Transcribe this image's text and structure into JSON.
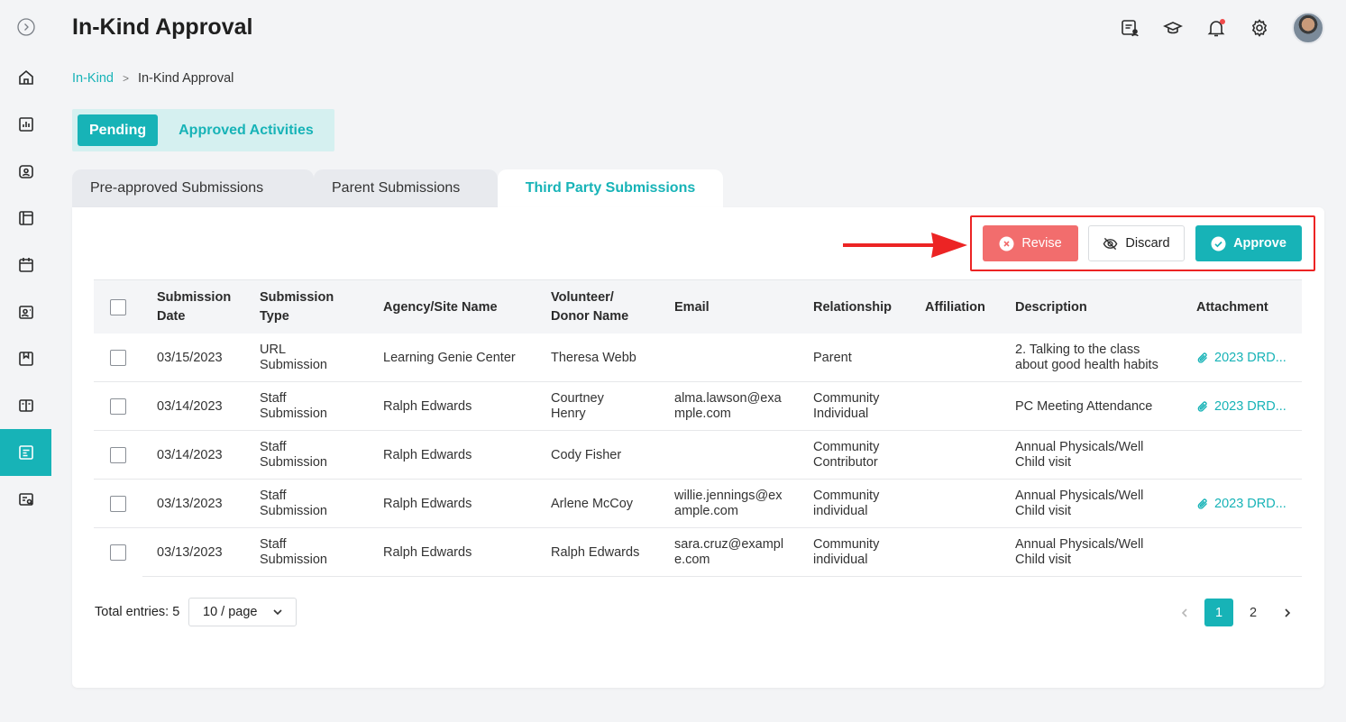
{
  "header": {
    "title": "In-Kind Approval",
    "icons": [
      "message-user-icon",
      "graduation-cap-icon",
      "bell-icon",
      "gear-icon",
      "avatar"
    ]
  },
  "breadcrumb": {
    "parent": "In-Kind",
    "separator": ">",
    "current": "In-Kind Approval"
  },
  "sidebar": {
    "items": [
      {
        "icon": "expand-icon"
      },
      {
        "icon": "home-icon"
      },
      {
        "icon": "bar-chart-icon"
      },
      {
        "icon": "id-card-icon"
      },
      {
        "icon": "layout-icon"
      },
      {
        "icon": "calendar-icon"
      },
      {
        "icon": "contact-card-icon"
      },
      {
        "icon": "bookmark-icon"
      },
      {
        "icon": "book-icon"
      },
      {
        "icon": "inkind-list-icon",
        "active": true
      },
      {
        "icon": "search-card-icon"
      }
    ]
  },
  "pill_tabs": {
    "pending": "Pending",
    "approved": "Approved Activities"
  },
  "folder_tabs": {
    "preapproved": "Pre-approved Submissions",
    "parent": "Parent Submissions",
    "third_party": "Third Party Submissions"
  },
  "actions": {
    "revise": "Revise",
    "discard": "Discard",
    "approve": "Approve"
  },
  "table": {
    "headers": {
      "date_1": "Submission",
      "date_2": "Date",
      "type_1": "Submission",
      "type_2": "Type",
      "agency": "Agency/Site Name",
      "volunteer_1": "Volunteer/",
      "volunteer_2": "Donor Name",
      "email": "Email",
      "relationship": "Relationship",
      "affiliation": "Affiliation",
      "description": "Description",
      "attachment": "Attachment"
    },
    "rows": [
      {
        "date": "03/15/2023",
        "type_1": "URL",
        "type_2": "Submission",
        "agency": "Learning Genie Center",
        "volunteer_1": "Theresa Webb",
        "volunteer_2": "",
        "email_1": "",
        "email_2": "",
        "relationship_1": "Parent",
        "relationship_2": "",
        "affiliation": "",
        "description_1": "2. Talking to the class",
        "description_2": "about good health habits",
        "attachment": "2023 DRD..."
      },
      {
        "date": "03/14/2023",
        "type_1": "Staff",
        "type_2": "Submission",
        "agency": "Ralph Edwards",
        "volunteer_1": "Courtney",
        "volunteer_2": "Henry",
        "email_1": "alma.lawson@exa",
        "email_2": "mple.com",
        "relationship_1": "Community",
        "relationship_2": "Individual",
        "affiliation": "",
        "description_1": "PC Meeting Attendance",
        "description_2": "",
        "attachment": "2023 DRD..."
      },
      {
        "date": "03/14/2023",
        "type_1": "Staff",
        "type_2": "Submission",
        "agency": "Ralph Edwards",
        "volunteer_1": "Cody Fisher",
        "volunteer_2": "",
        "email_1": "",
        "email_2": "",
        "relationship_1": "Community",
        "relationship_2": "Contributor",
        "affiliation": "",
        "description_1": "Annual Physicals/Well",
        "description_2": "Child visit",
        "attachment": ""
      },
      {
        "date": "03/13/2023",
        "type_1": "Staff",
        "type_2": "Submission",
        "agency": "Ralph Edwards",
        "volunteer_1": "Arlene McCoy",
        "volunteer_2": "",
        "email_1": "willie.jennings@ex",
        "email_2": "ample.com",
        "relationship_1": "Community",
        "relationship_2": "individual",
        "affiliation": "",
        "description_1": "Annual Physicals/Well",
        "description_2": "Child visit",
        "attachment": "2023 DRD..."
      },
      {
        "date": "03/13/2023",
        "type_1": "Staff",
        "type_2": "Submission",
        "agency": "Ralph Edwards",
        "volunteer_1": "Ralph Edwards",
        "volunteer_2": "",
        "email_1": "sara.cruz@exampl",
        "email_2": "e.com",
        "relationship_1": "Community",
        "relationship_2": "individual",
        "affiliation": "",
        "description_1": "Annual Physicals/Well",
        "description_2": "Child visit",
        "attachment": ""
      }
    ]
  },
  "footer": {
    "total_label": "Total entries: 5",
    "page_size": "10 / page",
    "pages": [
      "1",
      "2"
    ],
    "current_page": "1"
  },
  "colors": {
    "accent": "#17b3b7",
    "revise": "#f26d6d",
    "highlight": "#ec2424"
  }
}
